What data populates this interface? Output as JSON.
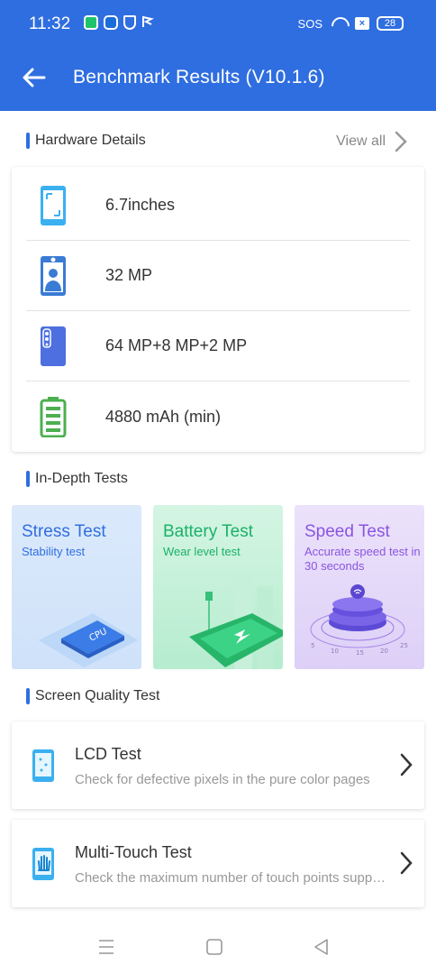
{
  "status_bar": {
    "time": "11:32",
    "sos": "SOS",
    "battery": "28"
  },
  "header": {
    "title": "Benchmark Results (V10.1.6)"
  },
  "hardware": {
    "section_title": "Hardware Details",
    "view_all": "View all",
    "items": [
      {
        "icon": "screen-icon",
        "text": "6.7inches"
      },
      {
        "icon": "front-camera-icon",
        "text": "32 MP"
      },
      {
        "icon": "rear-camera-icon",
        "text": "64 MP+8 MP+2 MP"
      },
      {
        "icon": "battery-icon",
        "text": "4880 mAh (min)"
      }
    ]
  },
  "indepth": {
    "section_title": "In-Depth Tests",
    "cards": [
      {
        "title": "Stress Test",
        "subtitle": "Stability test",
        "art_label": "CPU"
      },
      {
        "title": "Battery Test",
        "subtitle": "Wear level test"
      },
      {
        "title": "Speed Test",
        "subtitle_line1": "Accurate speed test in",
        "subtitle_line2": "30 seconds"
      }
    ]
  },
  "screen_quality": {
    "section_title": "Screen Quality Test",
    "items": [
      {
        "title": "LCD Test",
        "description": "Check for defective pixels in the pure color pages"
      },
      {
        "title": "Multi-Touch Test",
        "description": "Check the maximum number of touch points supported"
      }
    ]
  },
  "colors": {
    "brand": "#2f6ee0",
    "stress": "#2f6ee0",
    "battery": "#1bb168",
    "speed": "#8a55e0"
  }
}
